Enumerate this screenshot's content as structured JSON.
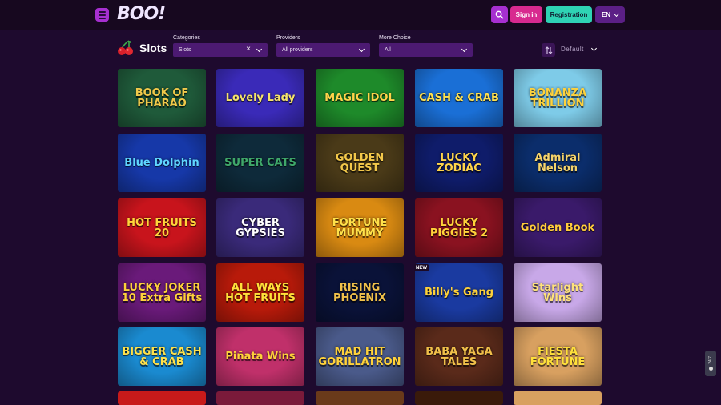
{
  "header": {
    "logo": "BOO!",
    "signin_label": "Sign in",
    "register_label": "Registration",
    "language": "EN"
  },
  "toolbar": {
    "title": "Slots",
    "categories": {
      "label": "Categories",
      "value": "Slots"
    },
    "providers": {
      "label": "Providers",
      "value": "All providers"
    },
    "more_choice": {
      "label": "More Choice",
      "value": "All"
    },
    "sort_value": "Default"
  },
  "games": [
    {
      "title": "BOOK OF PHARAO",
      "bg": "#1f5a3a",
      "color": "#f1c94a"
    },
    {
      "title": "Lovely Lady",
      "bg": "#3a2ab8",
      "color": "#f5e36a"
    },
    {
      "title": "MAGIC IDOL",
      "bg": "#1e8a2a",
      "color": "#ffd34a"
    },
    {
      "title": "CASH & CRAB",
      "bg": "#1a6fd6",
      "color": "#ffe14d"
    },
    {
      "title": "BONANZA TRILLION",
      "bg": "#7ecbe8",
      "color": "#ffd23a"
    },
    {
      "title": "Blue Dolphin",
      "bg": "#1638a8",
      "color": "#5fd6ff"
    },
    {
      "title": "SUPER CATS",
      "bg": "#0e2a3a",
      "color": "#3fa86a"
    },
    {
      "title": "GOLDEN QUEST",
      "bg": "#4a3a18",
      "color": "#f3c84a"
    },
    {
      "title": "LUCKY ZODIAC",
      "bg": "#0f1c6a",
      "color": "#ffd44a"
    },
    {
      "title": "Admiral Nelson",
      "bg": "#0b2d6b",
      "color": "#f5d36a"
    },
    {
      "title": "HOT FRUITS 20",
      "bg": "#c8141c",
      "color": "#ffd53a"
    },
    {
      "title": "CYBER GYPSIES",
      "bg": "#3a2a7a",
      "color": "#ffffff"
    },
    {
      "title": "FORTUNE MUMMY",
      "bg": "#d98a12",
      "color": "#ffe14a"
    },
    {
      "title": "LUCKY PIGGIES 2",
      "bg": "#8a1220",
      "color": "#ffd23a"
    },
    {
      "title": "Golden Book",
      "bg": "#3a1a6a",
      "color": "#ffcc3a"
    },
    {
      "title": "LUCKY JOKER 10 Extra Gifts",
      "bg": "#6a1a7a",
      "color": "#ffd23a"
    },
    {
      "title": "ALL WAYS HOT FRUITS",
      "bg": "#b81a0a",
      "color": "#ffe03a"
    },
    {
      "title": "RISING PHOENIX",
      "bg": "#0a1238",
      "color": "#f0c04a"
    },
    {
      "title": "Billy's Gang",
      "bg": "#1a3aa0",
      "color": "#ffd23a"
    },
    {
      "title": "Starlight Wins",
      "bg": "#c8a8e8",
      "color": "#ffe27a"
    },
    {
      "title": "BIGGER CASH & CRAB",
      "bg": "#1a8ad0",
      "color": "#ffe14a"
    },
    {
      "title": "Piñata Wins",
      "bg": "#c0306a",
      "color": "#ffd23a"
    },
    {
      "title": "MAD HIT GORILLATRON",
      "bg": "#4a5a8a",
      "color": "#ffd23a"
    },
    {
      "title": "BABA YAGA TALES",
      "bg": "#5a2a1a",
      "color": "#f0c04a"
    },
    {
      "title": "FIESTA FORTUNE",
      "bg": "#d8a060",
      "color": "#ffe03a"
    }
  ],
  "badge_new": "NEW",
  "chat_label": "24/7",
  "colors": {
    "accent": "#a62fd0",
    "signin": "#d82a8f",
    "register": "#2fd3b4",
    "background": "#1e0a2e"
  }
}
